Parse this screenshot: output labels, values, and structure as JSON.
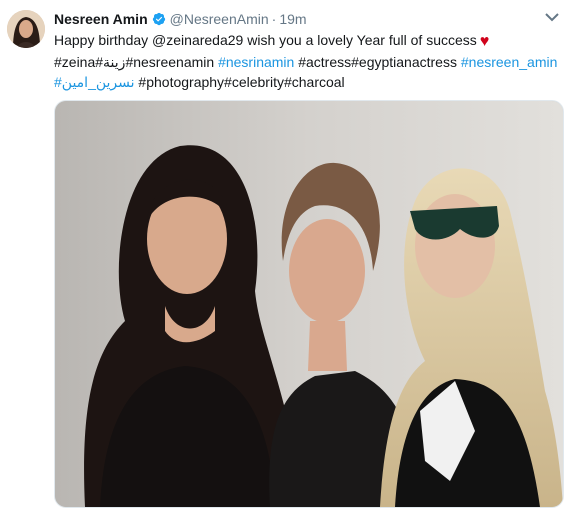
{
  "tweet": {
    "author_name": "Nesreen Amin",
    "author_handle": "@NesreenAmin",
    "separator": "·",
    "time": "19m",
    "line1_text": "Happy birthday @zeinareda29 wish you a lovely Year full of success",
    "line2_a": "#zeina#زينة#nesreenamin",
    "line2_link1": "#nesrinamin",
    "line2_b": "#actress#egyptianactress",
    "line2_link2": "#nesreen_amin",
    "line3_link": "#نسرين_امين",
    "line3_b": "#photography#celebrity#charcoal",
    "heart_glyph": "♥"
  },
  "colors": {
    "link": "#1b95e0",
    "verified": "#1da1f2",
    "muted": "#657786",
    "heart": "#d0021b"
  },
  "icons": [
    "verified-badge-icon",
    "chevron-down-icon",
    "heart-emoji"
  ]
}
